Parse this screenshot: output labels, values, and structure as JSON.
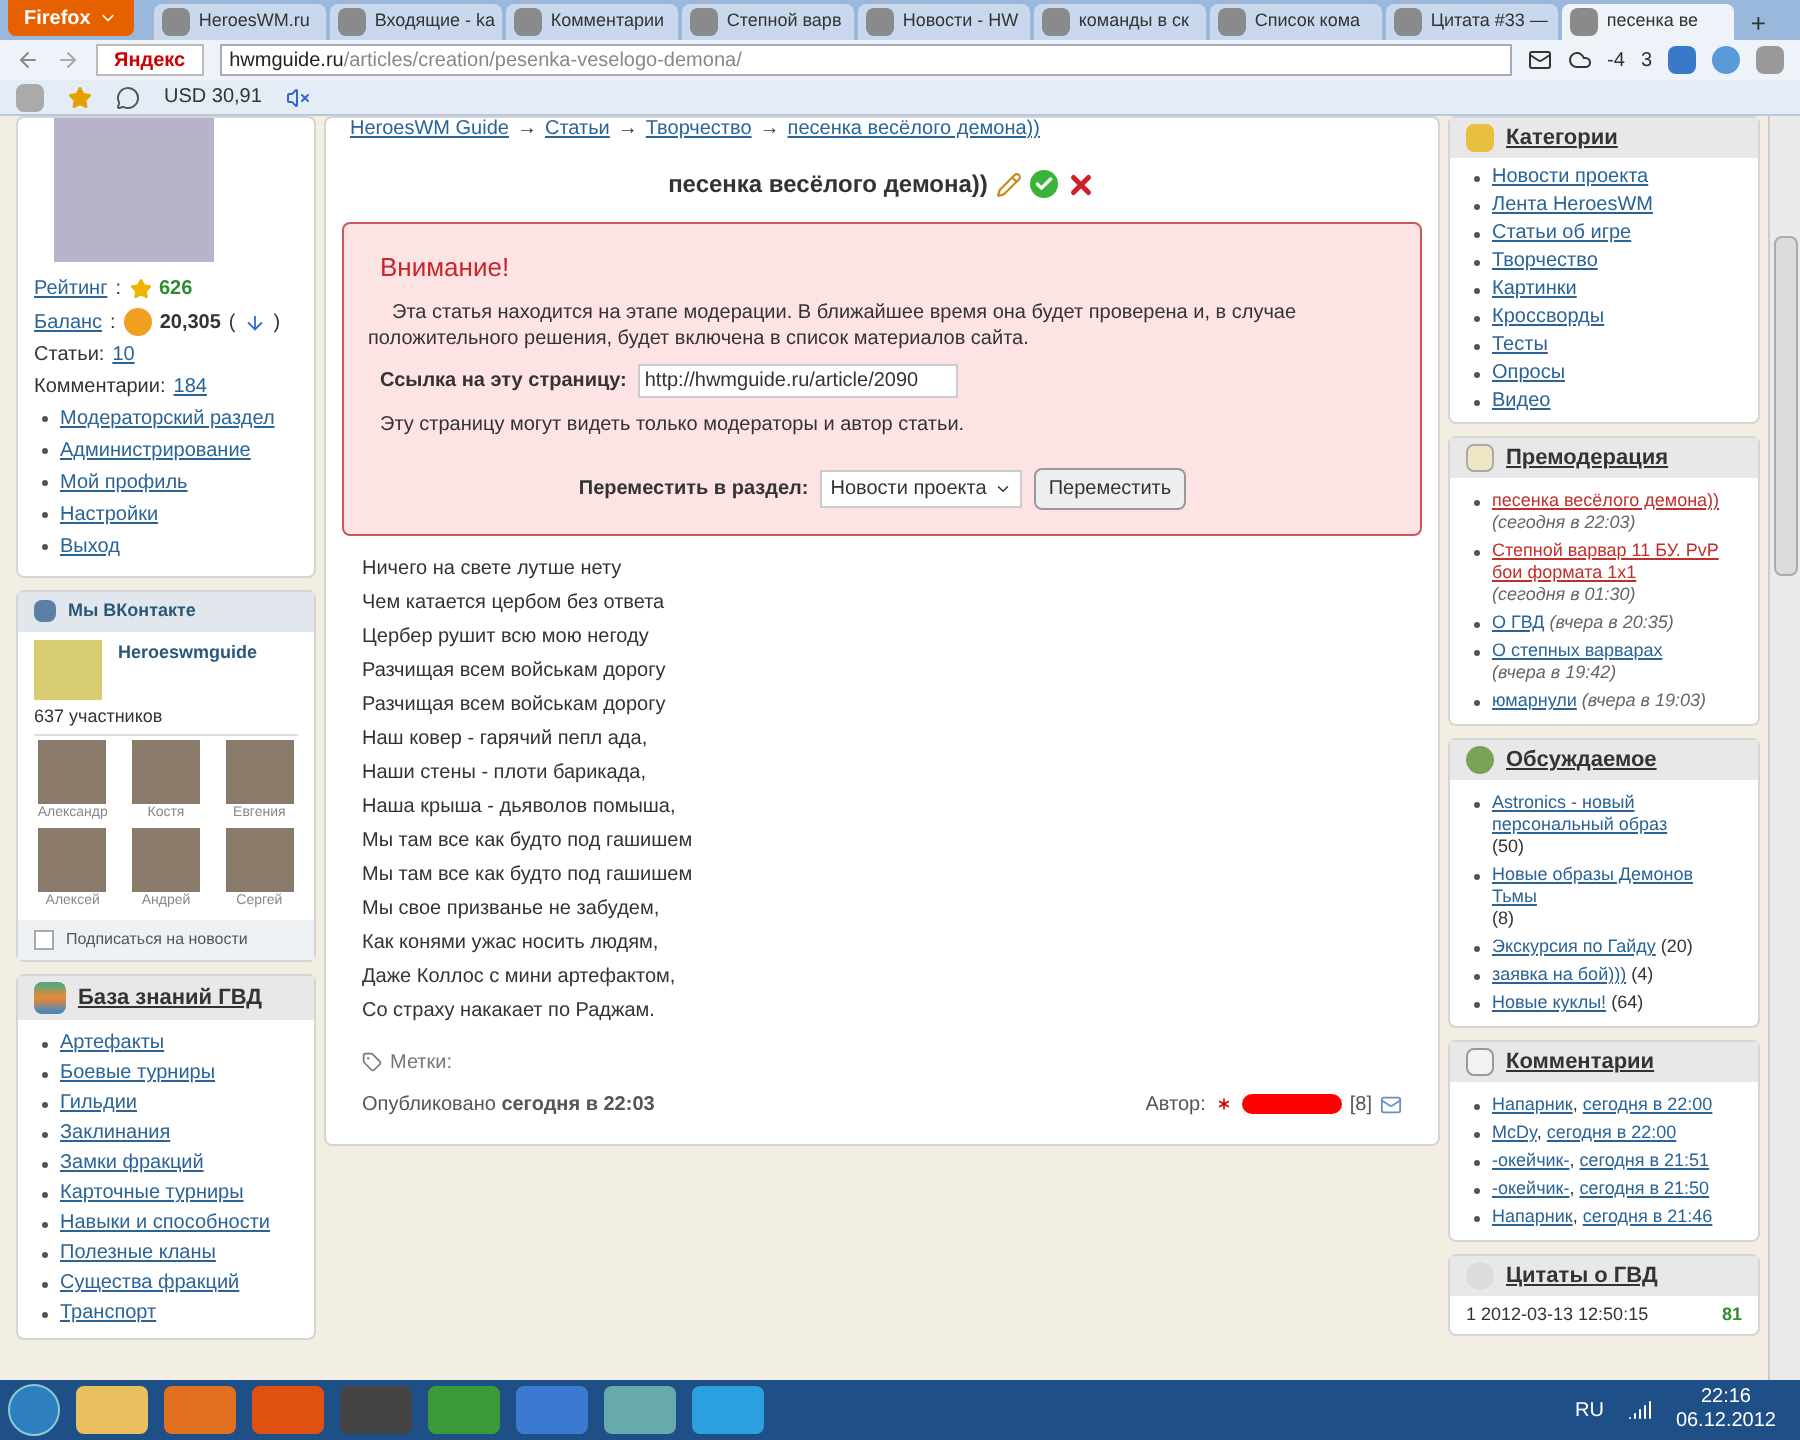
{
  "browser": {
    "menu_button": "Firefox",
    "tabs": [
      {
        "label": "HeroesWM.ru",
        "selected": false
      },
      {
        "label": "Входящие - ka",
        "selected": false
      },
      {
        "label": "Комментарии",
        "selected": false
      },
      {
        "label": "Степной варв",
        "selected": false
      },
      {
        "label": "Новости - HW",
        "selected": false
      },
      {
        "label": "команды в ск",
        "selected": false
      },
      {
        "label": "Список кома",
        "selected": false
      },
      {
        "label": "Цитата #33 —",
        "selected": false
      },
      {
        "label": "песенка ве",
        "selected": true
      }
    ],
    "new_tab": "+",
    "search_engine": "Яндекс",
    "url_host": "hwmguide.ru",
    "url_path": "/articles/creation/pesenka-veselogo-demona/",
    "weather": "-4",
    "counter": "3",
    "currency": "USD 30,91"
  },
  "profile": {
    "rating_label": "Рейтинг",
    "rating": "626",
    "balance_label": "Баланс",
    "balance": "20,305",
    "articles_label": "Статьи:",
    "articles": "10",
    "comments_label": "Комментарии:",
    "comments": "184",
    "colon": ":",
    "paren_open": "(",
    "paren_close": ")",
    "links": [
      "Модераторский раздел",
      "Администрирование",
      "Мой профиль",
      "Настройки",
      "Выход"
    ]
  },
  "vk": {
    "title": "Мы ВКонтакте",
    "group": "Heroeswmguide",
    "members_count": "637 участников",
    "members": [
      "Александр",
      "Костя",
      "Евгения",
      "Алексей",
      "Андрей",
      "Сергей"
    ],
    "subscribe": {
      "label": "Подписаться на новости",
      "checked": false
    }
  },
  "knowledge": {
    "title": "База знаний ГВД",
    "items": [
      "Артефакты",
      "Боевые турниры",
      "Гильдии",
      "Заклинания",
      "Замки фракций",
      "Карточные турниры",
      "Навыки и способности",
      "Полезные кланы",
      "Существа фракций",
      "Транспорт"
    ]
  },
  "article": {
    "breadcrumbs": [
      "HeroesWM Guide",
      "Статьи",
      "Творчество",
      "песенка весёлого демона))"
    ],
    "separator": "→",
    "title": "песенка весёлого демона))",
    "notice": {
      "heading": "Внимание!",
      "text": "Эта статья находится на этапе модерации. В ближайшее время она будет проверена и, в случае положительного решения, будет включена в список материалов сайта.",
      "link_label": "Ссылка на эту страницу:",
      "link_value": "http://hwmguide.ru/article/2090",
      "visibility": "Эту страницу могут видеть только модераторы и автор статьи.",
      "move_label": "Переместить в раздел:",
      "move_select": "Новости проекта",
      "move_button": "Переместить"
    },
    "lines": [
      "Ничего на свете лутше нету",
      "Чем катается цербом без ответа",
      "Цербер рушит всю мою негоду",
      "Разчищая всем войськам дорогу",
      "Разчищая всем войськам дорогу",
      "Наш ковер - гарячий пепл ада,",
      "Наши стены - плоти барикада,",
      "Наша крыша - дьяволов помыша,",
      "Мы там все как будто под гашишем",
      "Мы там все как будто под гашишем",
      "Мы свое призванье не забудем,",
      "Как конями ужас носить людям,",
      "Даже Коллос с мини артефактом,",
      "Со страху накакает по Раджам."
    ],
    "tags_label": "Метки:",
    "published": "Опубликовано **сегодня в 22:03**",
    "author_label": "Автор:",
    "author_level": "[8]"
  },
  "categories": {
    "title": "Категории",
    "items": [
      "Новости проекта",
      "Лента HeroesWM",
      "Статьи об игре",
      "Творчество",
      "Картинки",
      "Кроссворды",
      "Тесты",
      "Опросы",
      "Видео"
    ]
  },
  "premoderation": {
    "title": "Премодерация",
    "items": [
      {
        "title": "песенка весёлого демона))",
        "time": "(сегодня в 22:03)",
        "highlighted": true
      },
      {
        "title": "Степной варвар 11 БУ. PvP бои формата 1х1",
        "time": "(сегодня в 01:30)",
        "highlighted": true
      },
      {
        "title": "О ГВД",
        "time": "(вчера в 20:35)",
        "highlighted": false
      },
      {
        "title": "О степных варварах",
        "time": "(вчера в 19:42)",
        "highlighted": false
      },
      {
        "title": "юмарнули",
        "time": "(вчера в 19:03)",
        "highlighted": false
      }
    ]
  },
  "discussed": {
    "title": "Обсуждаемое",
    "items": [
      {
        "title": "Astronics - новый персональный образ",
        "count": "(50)"
      },
      {
        "title": "Новые образы Демонов Тьмы",
        "count": "(8)"
      },
      {
        "title": "Экскурсия по Гайду",
        "count": "(20)"
      },
      {
        "title": "заявка на бой)))",
        "count": "(4)"
      },
      {
        "title": "Новые куклы!",
        "count": "(64)"
      }
    ]
  },
  "comments": {
    "title": "Комментарии",
    "separator": ",",
    "items": [
      {
        "author": "Напарник",
        "time": "сегодня в 22:00"
      },
      {
        "author": "McDy",
        "time": "сегодня в 22:00"
      },
      {
        "author": "-окейчик-",
        "time": "сегодня в 21:51"
      },
      {
        "author": "-окейчик-",
        "time": "сегодня в 21:50"
      },
      {
        "author": "Напарник",
        "time": "сегодня в 21:46"
      }
    ]
  },
  "quotes": {
    "title": "Цитаты о ГВД",
    "entry": "1 2012-03-13 12:50:15",
    "score": "81"
  },
  "taskbar": {
    "language": "RU",
    "time": "22:16",
    "date": "06.12.2012"
  }
}
